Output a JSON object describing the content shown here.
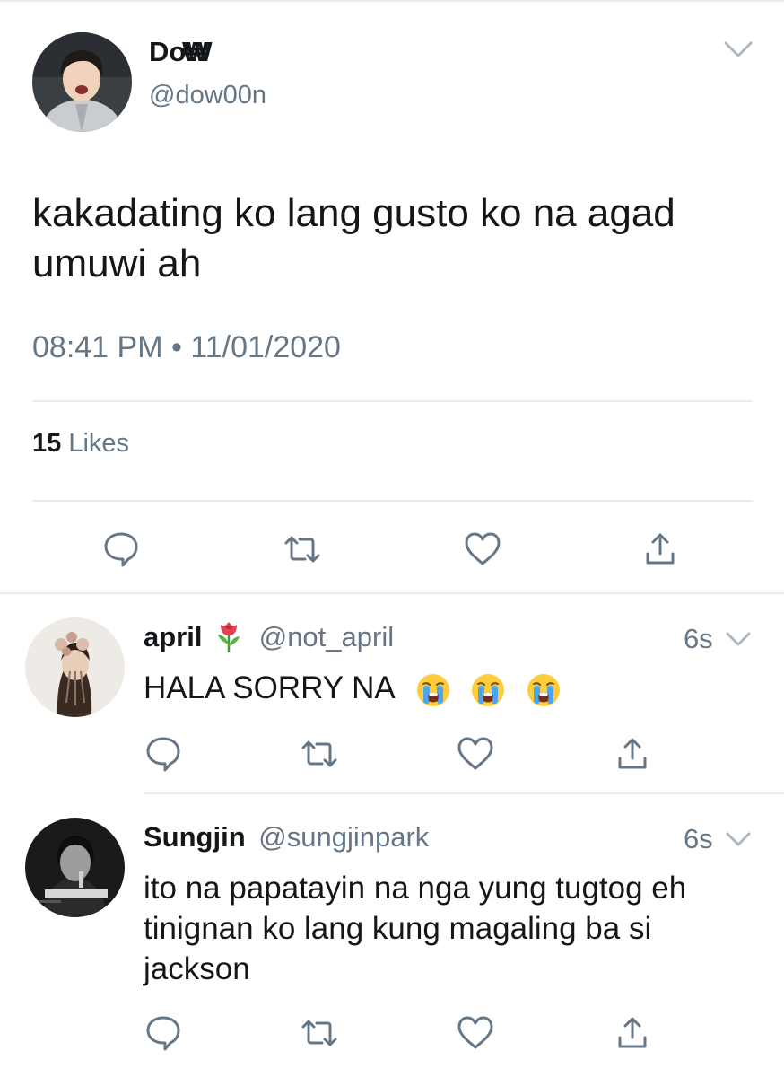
{
  "tweet": {
    "display_name": "DoW",
    "display_name_suffix": "₩",
    "handle": "@dow00n",
    "text": "kakadating ko lang gusto ko na agad umuwi ah",
    "timestamp": "08:41 PM • 11/01/2020",
    "likes_count": "15",
    "likes_label": " Likes",
    "actions": [
      "reply-icon",
      "retweet-icon",
      "like-icon",
      "share-icon"
    ]
  },
  "replies": [
    {
      "display_name": "april",
      "name_emoji": "rose-emoji",
      "handle": "@not_april",
      "ago": "6s",
      "text": "HALA SORRY NA",
      "text_emojis": [
        "loudly-crying-face",
        "loudly-crying-face",
        "loudly-crying-face"
      ]
    },
    {
      "display_name": "Sungjin",
      "handle": "@sungjinpark",
      "ago": "6s",
      "text": "ito na papatayin na nga yung tugtog eh tinignan ko lang kung magaling ba si jackson"
    }
  ],
  "colors": {
    "text": "#14171a",
    "secondary": "#657786",
    "divider": "#e6ecf0",
    "icon": "#657786"
  }
}
